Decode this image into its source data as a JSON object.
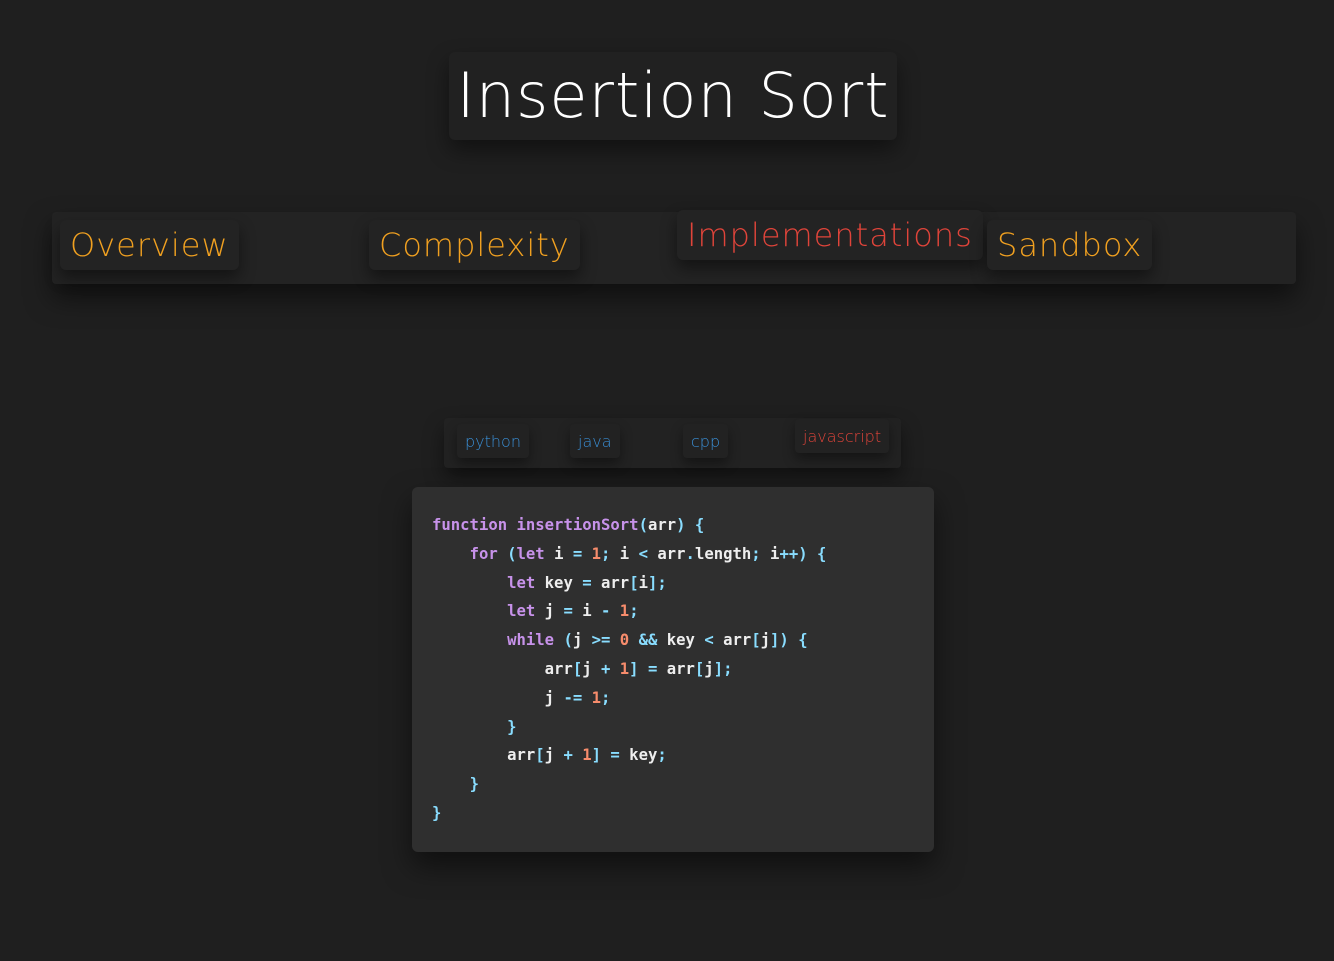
{
  "page": {
    "title": "Insertion Sort"
  },
  "nav": {
    "active": "Implementations",
    "tabs": [
      {
        "id": "overview",
        "label": "Overview"
      },
      {
        "id": "complexity",
        "label": "Complexity"
      },
      {
        "id": "implementations",
        "label": "Implementations"
      },
      {
        "id": "sandbox",
        "label": "Sandbox"
      }
    ]
  },
  "languages": {
    "active": "javascript",
    "tabs": [
      {
        "id": "python",
        "label": "python"
      },
      {
        "id": "java",
        "label": "java"
      },
      {
        "id": "cpp",
        "label": "cpp"
      },
      {
        "id": "javascript",
        "label": "javascript"
      }
    ]
  },
  "code": {
    "language": "javascript",
    "lines": [
      [
        [
          "kw",
          "function"
        ],
        [
          "plain",
          " "
        ],
        [
          "fn",
          "insertionSort"
        ],
        [
          "punc",
          "("
        ],
        [
          "plain",
          "arr"
        ],
        [
          "punc",
          ")"
        ],
        [
          "plain",
          " "
        ],
        [
          "punc",
          "{"
        ]
      ],
      [
        [
          "plain",
          "    "
        ],
        [
          "kw",
          "for"
        ],
        [
          "plain",
          " "
        ],
        [
          "punc",
          "("
        ],
        [
          "kw",
          "let"
        ],
        [
          "plain",
          " i "
        ],
        [
          "op",
          "="
        ],
        [
          "plain",
          " "
        ],
        [
          "num",
          "1"
        ],
        [
          "punc",
          ";"
        ],
        [
          "plain",
          " i "
        ],
        [
          "op",
          "<"
        ],
        [
          "plain",
          " arr"
        ],
        [
          "punc",
          "."
        ],
        [
          "plain",
          "length"
        ],
        [
          "punc",
          ";"
        ],
        [
          "plain",
          " i"
        ],
        [
          "op",
          "++"
        ],
        [
          "punc",
          ")"
        ],
        [
          "plain",
          " "
        ],
        [
          "punc",
          "{"
        ]
      ],
      [
        [
          "plain",
          "        "
        ],
        [
          "kw",
          "let"
        ],
        [
          "plain",
          " key "
        ],
        [
          "op",
          "="
        ],
        [
          "plain",
          " arr"
        ],
        [
          "punc",
          "["
        ],
        [
          "plain",
          "i"
        ],
        [
          "punc",
          "];"
        ]
      ],
      [
        [
          "plain",
          "        "
        ],
        [
          "kw",
          "let"
        ],
        [
          "plain",
          " j "
        ],
        [
          "op",
          "="
        ],
        [
          "plain",
          " i "
        ],
        [
          "op",
          "-"
        ],
        [
          "plain",
          " "
        ],
        [
          "num",
          "1"
        ],
        [
          "punc",
          ";"
        ]
      ],
      [
        [
          "plain",
          "        "
        ],
        [
          "kw",
          "while"
        ],
        [
          "plain",
          " "
        ],
        [
          "punc",
          "("
        ],
        [
          "plain",
          "j "
        ],
        [
          "op",
          ">="
        ],
        [
          "plain",
          " "
        ],
        [
          "num",
          "0"
        ],
        [
          "plain",
          " "
        ],
        [
          "op",
          "&&"
        ],
        [
          "plain",
          " key "
        ],
        [
          "op",
          "<"
        ],
        [
          "plain",
          " arr"
        ],
        [
          "punc",
          "["
        ],
        [
          "plain",
          "j"
        ],
        [
          "punc",
          "])"
        ],
        [
          "plain",
          " "
        ],
        [
          "punc",
          "{"
        ]
      ],
      [
        [
          "plain",
          "            arr"
        ],
        [
          "punc",
          "["
        ],
        [
          "plain",
          "j "
        ],
        [
          "op",
          "+"
        ],
        [
          "plain",
          " "
        ],
        [
          "num",
          "1"
        ],
        [
          "punc",
          "]"
        ],
        [
          "plain",
          " "
        ],
        [
          "op",
          "="
        ],
        [
          "plain",
          " arr"
        ],
        [
          "punc",
          "["
        ],
        [
          "plain",
          "j"
        ],
        [
          "punc",
          "];"
        ]
      ],
      [
        [
          "plain",
          "            j "
        ],
        [
          "op",
          "-="
        ],
        [
          "plain",
          " "
        ],
        [
          "num",
          "1"
        ],
        [
          "punc",
          ";"
        ]
      ],
      [
        [
          "plain",
          "        "
        ],
        [
          "punc",
          "}"
        ]
      ],
      [
        [
          "plain",
          "        arr"
        ],
        [
          "punc",
          "["
        ],
        [
          "plain",
          "j "
        ],
        [
          "op",
          "+"
        ],
        [
          "plain",
          " "
        ],
        [
          "num",
          "1"
        ],
        [
          "punc",
          "]"
        ],
        [
          "plain",
          " "
        ],
        [
          "op",
          "="
        ],
        [
          "plain",
          " key"
        ],
        [
          "punc",
          ";"
        ]
      ],
      [
        [
          "plain",
          "    "
        ],
        [
          "punc",
          "}"
        ]
      ],
      [
        [
          "punc",
          "}"
        ]
      ]
    ]
  },
  "colors": {
    "background": "#1f1f1f",
    "nav_tab": "#f0a020",
    "active_tab": "#e0443a",
    "lang_tab": "#3a8fd6",
    "code_background": "#2f2f2f",
    "keyword": "#c792ea",
    "number": "#f78c6c",
    "operator": "#89ddff"
  }
}
